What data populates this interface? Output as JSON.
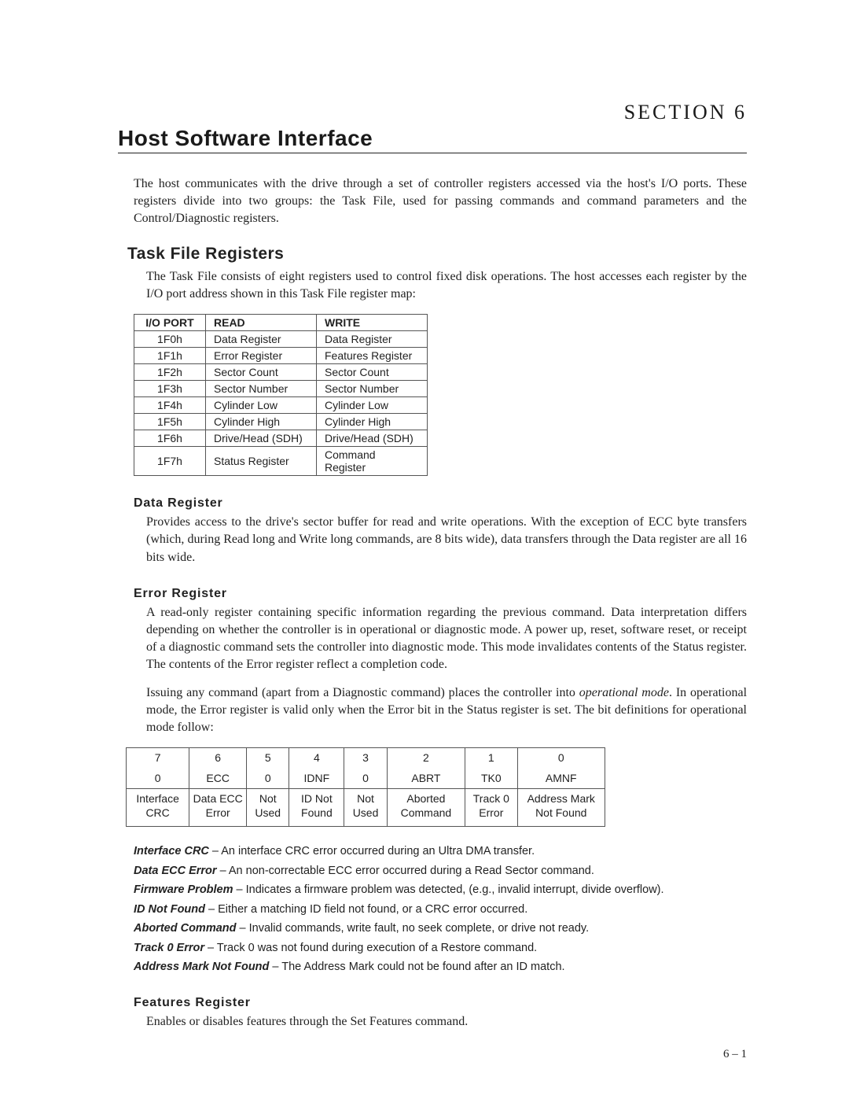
{
  "section_label": "SECTION 6",
  "title": "Host Software Interface",
  "intro": "The host communicates with the drive through a set of controller registers accessed via the host's I/O ports. These registers divide into two groups: the Task File, used for passing commands and command parameters and the Control/Diagnostic registers.",
  "task_file": {
    "heading": "Task File Registers",
    "para": "The Task File consists of eight registers used to control fixed disk operations. The host accesses each register by the I/O port address shown in this Task File register map:",
    "table_head": {
      "port": "I/O PORT",
      "read": "READ",
      "write": "WRITE"
    },
    "rows": [
      {
        "port": "1F0h",
        "read": "Data Register",
        "write": "Data Register"
      },
      {
        "port": "1F1h",
        "read": "Error Register",
        "write": "Features Register"
      },
      {
        "port": "1F2h",
        "read": "Sector Count",
        "write": "Sector Count"
      },
      {
        "port": "1F3h",
        "read": "Sector Number",
        "write": "Sector Number"
      },
      {
        "port": "1F4h",
        "read": "Cylinder Low",
        "write": "Cylinder Low"
      },
      {
        "port": "1F5h",
        "read": "Cylinder High",
        "write": "Cylinder High"
      },
      {
        "port": "1F6h",
        "read": "Drive/Head (SDH)",
        "write": "Drive/Head (SDH)"
      },
      {
        "port": "1F7h",
        "read": "Status Register",
        "write": "Command Register"
      }
    ]
  },
  "data_reg": {
    "heading": "Data Register",
    "para": "Provides access to the drive's sector buffer for read and write operations. With the exception of ECC byte transfers (which, during Read long and Write long commands, are 8 bits wide), data transfers through the Data register are all 16 bits wide."
  },
  "error_reg": {
    "heading": "Error Register",
    "para1": "A read-only register containing specific information regarding the previous command. Data interpretation differs depending on whether the controller is in operational or diagnostic mode. A power up, reset, software reset, or receipt of a diagnostic command sets the controller into diagnostic mode. This mode invalidates contents of the Status register. The contents of the Error register reflect a completion code.",
    "para2_pre": "Issuing any command (apart from a Diagnostic command) places the controller into ",
    "para2_em": "operational mode",
    "para2_post": ". In operational mode, the Error register is valid only when the Error bit in the Status register is set. The bit definitions for operational mode follow:",
    "bits": {
      "nums": [
        "7",
        "6",
        "5",
        "4",
        "3",
        "2",
        "1",
        "0"
      ],
      "codes": [
        "0",
        "ECC",
        "0",
        "IDNF",
        "0",
        "ABRT",
        "TK0",
        "AMNF"
      ],
      "descs": [
        "Interface CRC",
        "Data ECC Error",
        "Not Used",
        "ID Not Found",
        "Not Used",
        "Aborted Command",
        "Track 0 Error",
        "Address Mark Not Found"
      ]
    },
    "defs": [
      {
        "term": "Interface CRC",
        "text": " – An interface CRC error occurred during an Ultra DMA transfer."
      },
      {
        "term": "Data ECC Error",
        "text": " – An non-correctable ECC error occurred during a Read Sector command."
      },
      {
        "term": "Firmware Problem",
        "text": " – Indicates a firmware problem was detected, (e.g., invalid interrupt, divide overflow)."
      },
      {
        "term": "ID Not Found",
        "text": " – Either a matching ID field not found, or a CRC error occurred."
      },
      {
        "term": "Aborted Command",
        "text": " – Invalid commands, write fault, no seek complete, or drive not ready."
      },
      {
        "term": "Track 0 Error",
        "text": " – Track 0 was not found during execution of a Restore command."
      },
      {
        "term": "Address Mark Not Found",
        "text": " – The Address Mark could not be found after an ID match."
      }
    ]
  },
  "features_reg": {
    "heading": "Features Register",
    "para": "Enables or disables features through the Set Features command."
  },
  "page_number": "6 – 1"
}
